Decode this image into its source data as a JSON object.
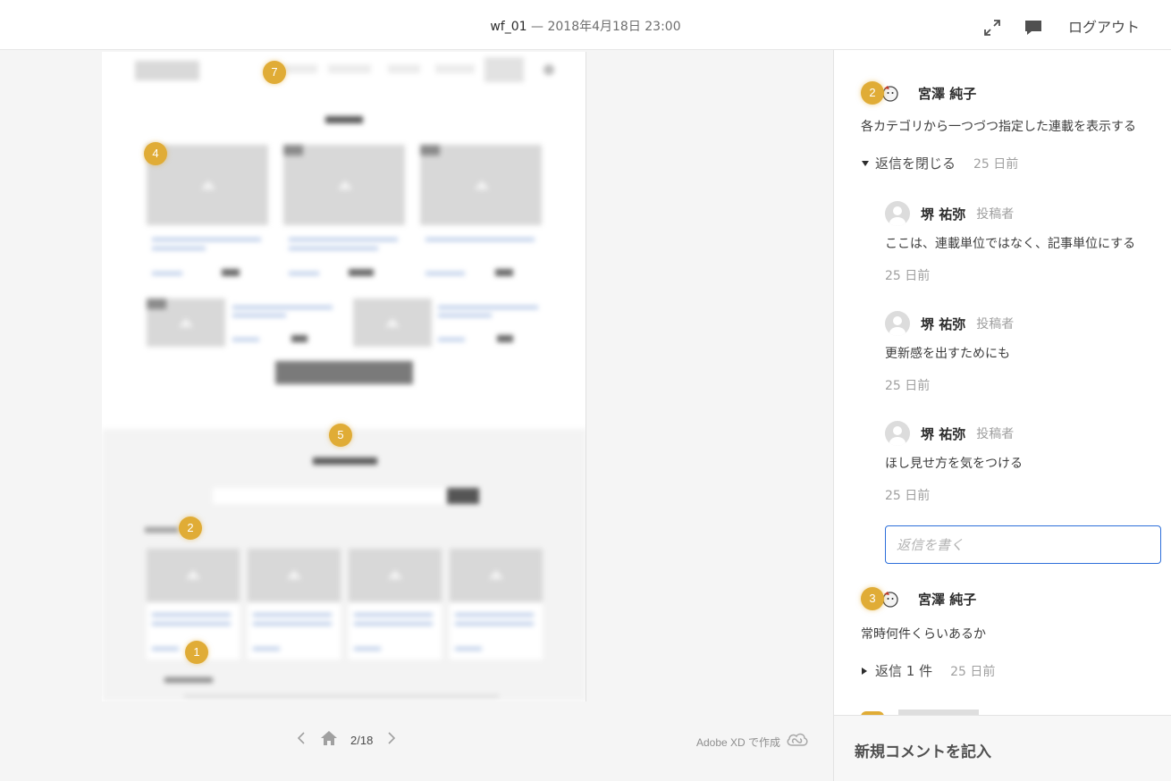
{
  "header": {
    "file_name": "wf_01",
    "separator": "—",
    "timestamp": "2018年4月18日 23:00",
    "fullscreen_icon": "expand-arrows-icon",
    "comment_icon": "speech-bubble-icon",
    "logout_label": "ログアウト"
  },
  "canvas": {
    "pins": [
      "7",
      "4",
      "5",
      "2",
      "1"
    ]
  },
  "footer": {
    "prev_icon": "chevron-left-icon",
    "home_icon": "home-icon",
    "page": "2/18",
    "next_icon": "chevron-right-icon",
    "made_with": "Adobe XD で作成",
    "cc_icon": "creative-cloud-icon"
  },
  "comments": {
    "threads": [
      {
        "pin": "2",
        "author": "宮澤 純子",
        "text": "各カテゴリから一つづつ指定した連載を表示する",
        "toggle_label": "返信を閉じる",
        "time": "25 日前",
        "replies": [
          {
            "author": "堺 祐弥",
            "role": "投稿者",
            "text": "ここは、連載単位ではなく、記事単位にする",
            "time": "25 日前"
          },
          {
            "author": "堺 祐弥",
            "role": "投稿者",
            "text": "更新感を出すためにも",
            "time": "25 日前"
          },
          {
            "author": "堺 祐弥",
            "role": "投稿者",
            "text": "ほし見せ方を気をつける",
            "time": "25 日前"
          }
        ],
        "reply_placeholder": "返信を書く"
      },
      {
        "pin": "3",
        "author": "宮澤 純子",
        "text": "常時何件くらいあるか",
        "toggle_label": "返信 1 件",
        "time": "25 日前"
      }
    ],
    "new_comment_label": "新規コメントを記入"
  },
  "colors": {
    "pin": "#e0ac36",
    "input_focus": "#2d6fda"
  }
}
